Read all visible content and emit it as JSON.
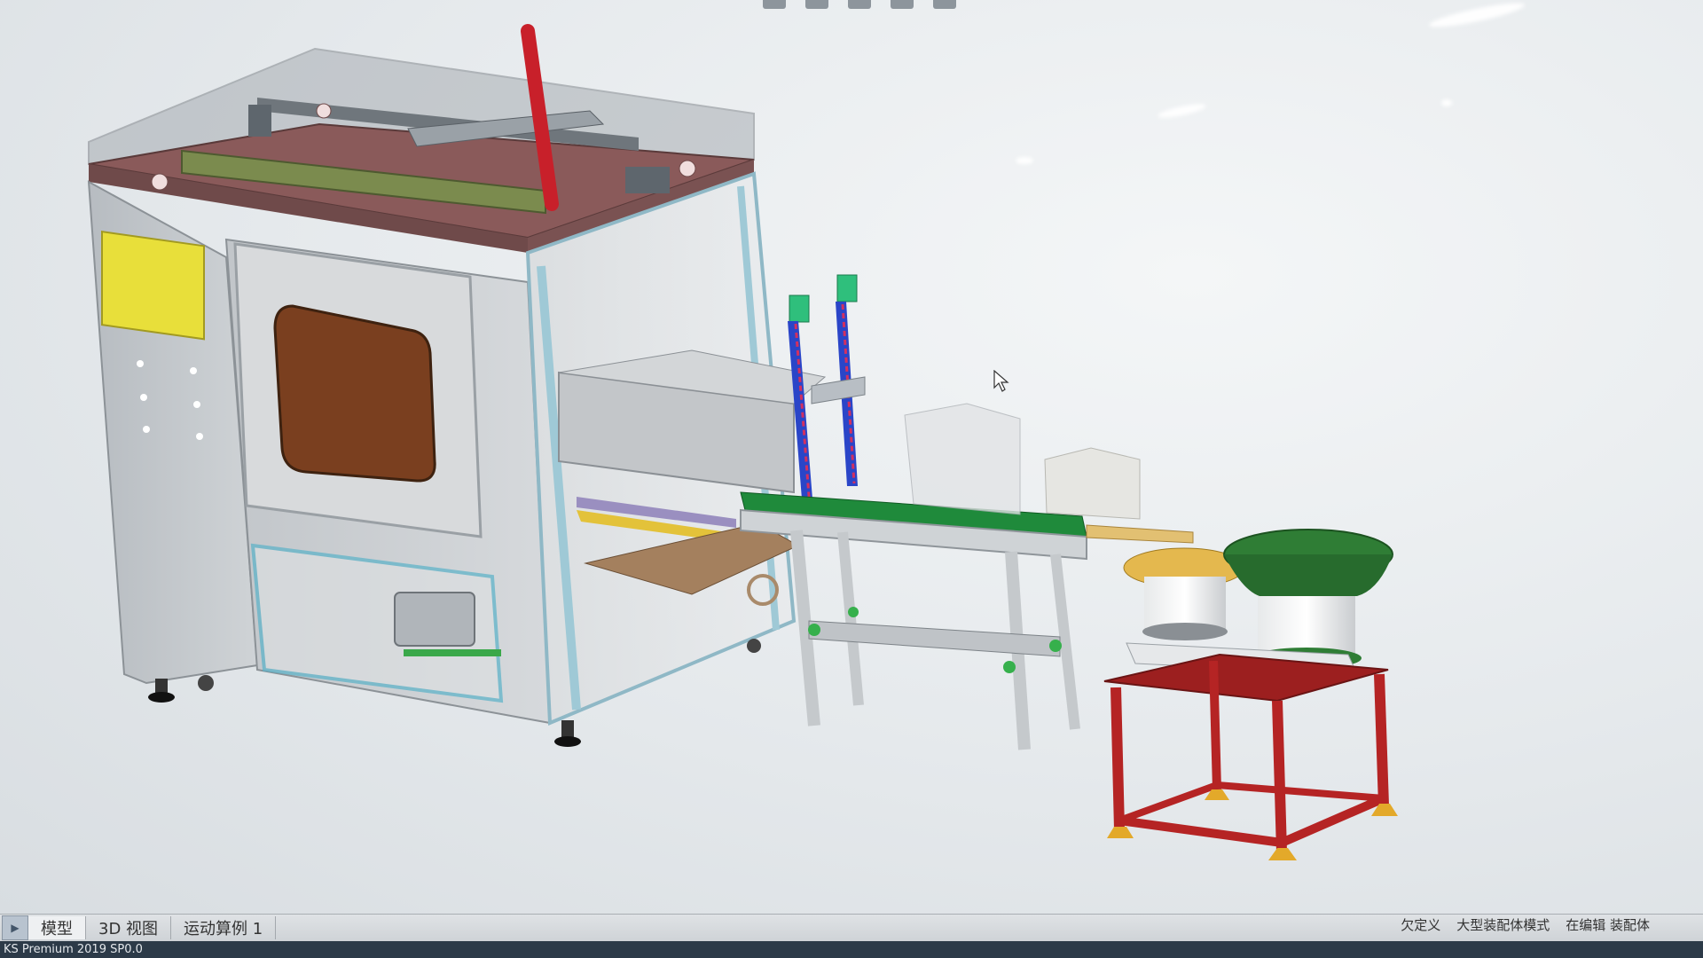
{
  "tabs": [
    {
      "label": "模型",
      "active": true
    },
    {
      "label": "3D 视图",
      "active": false
    },
    {
      "label": "运动算例 1",
      "active": false
    }
  ],
  "status": {
    "underdefined": "欠定义",
    "large_assembly_mode": "大型装配体模式",
    "editing": "在编辑 装配体"
  },
  "app_version": "KS Premium 2019 SP0.0",
  "colors": {
    "frame": "#c9cdd1",
    "top_plate": "#8a5a5a",
    "door_window": "#7a3f1f",
    "yellow_panel": "#e8df3a",
    "blue_rail": "#2a45c8",
    "green_belt": "#1f8a3b",
    "red_stand": "#b52424",
    "bowl_green": "#2f7d35",
    "gold_feet": "#e3a92a"
  },
  "icons": [
    "nav-arrow-icon",
    "cursor-icon"
  ]
}
